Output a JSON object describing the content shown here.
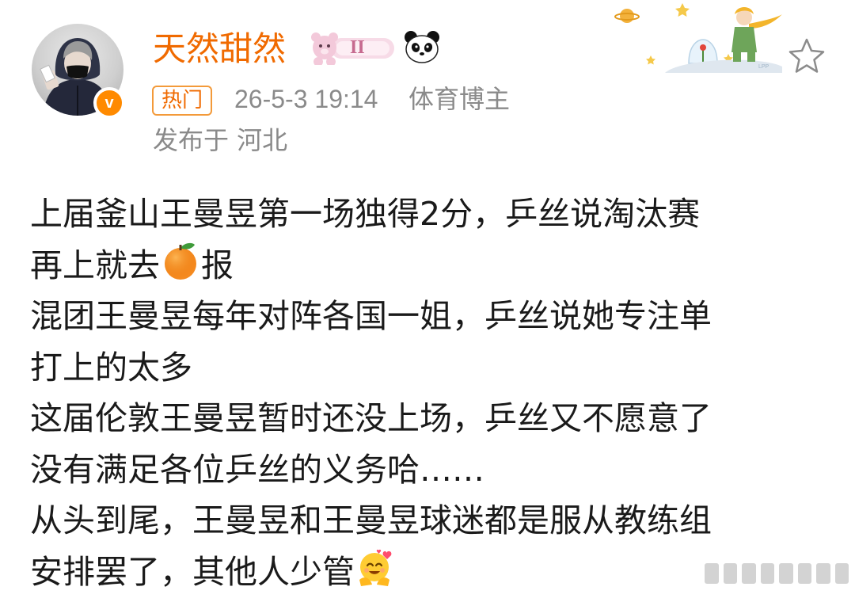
{
  "author": {
    "name": "天然甜然",
    "badge_text": "II",
    "verified_mark": "v"
  },
  "post_meta": {
    "hot_tag": "热门",
    "time": "26-5-3 19:14",
    "role": "体育博主",
    "location": "发布于 河北"
  },
  "content": {
    "line1": "上届釜山王曼昱第一场独得2分，乒丝说淘汰赛",
    "line2_before": "再上就去",
    "line2_after": "报",
    "line3": "混团王曼昱每年对阵各国一姐，乒丝说她专注单",
    "line4": "打上的太多",
    "line5": "这届伦敦王曼昱暂时还没上场，乒丝又不愿意了",
    "line6": "没有满足各位乒丝的义务哈……",
    "line7": "从头到尾，王曼昱和王曼昱球迷都是服从教练组",
    "line8": "安排罢了，其他人少管"
  },
  "icons": {
    "orange": "orange-emoji-icon",
    "hug": "hug-emoji-icon",
    "star": "star-icon",
    "panda": "panda-icon"
  },
  "colors": {
    "username": "#f06a00",
    "verified": "#ff8a00",
    "meta": "#8a8a8a",
    "text": "#1a1a1a"
  }
}
